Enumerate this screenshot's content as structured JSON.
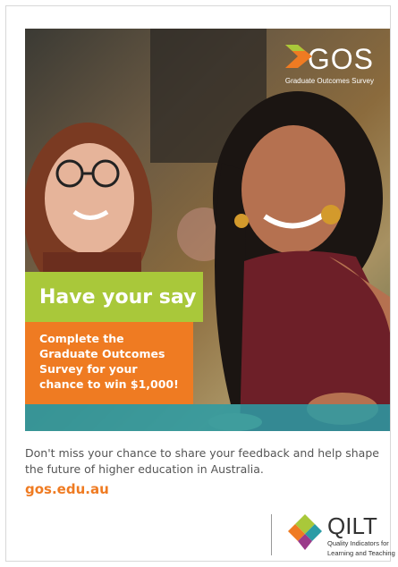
{
  "logo": {
    "brand": "GOS",
    "subtitle": "Graduate Outcomes Survey"
  },
  "headline": "Have your say",
  "promo": {
    "lines": [
      "Complete the",
      "Graduate Outcomes",
      "Survey for your",
      "chance to win $1,000!"
    ]
  },
  "body": "Don't miss your chance to share your feedback and help shape the future of higher education in Australia.",
  "website": "gos.edu.au",
  "footer_logo": {
    "name": "QILT",
    "tagline_line1": "Quality Indicators for",
    "tagline_line2": "Learning and Teaching"
  },
  "colors": {
    "green": "#a9c83a",
    "orange": "#ef7b22",
    "teal": "#2a9ca6"
  }
}
